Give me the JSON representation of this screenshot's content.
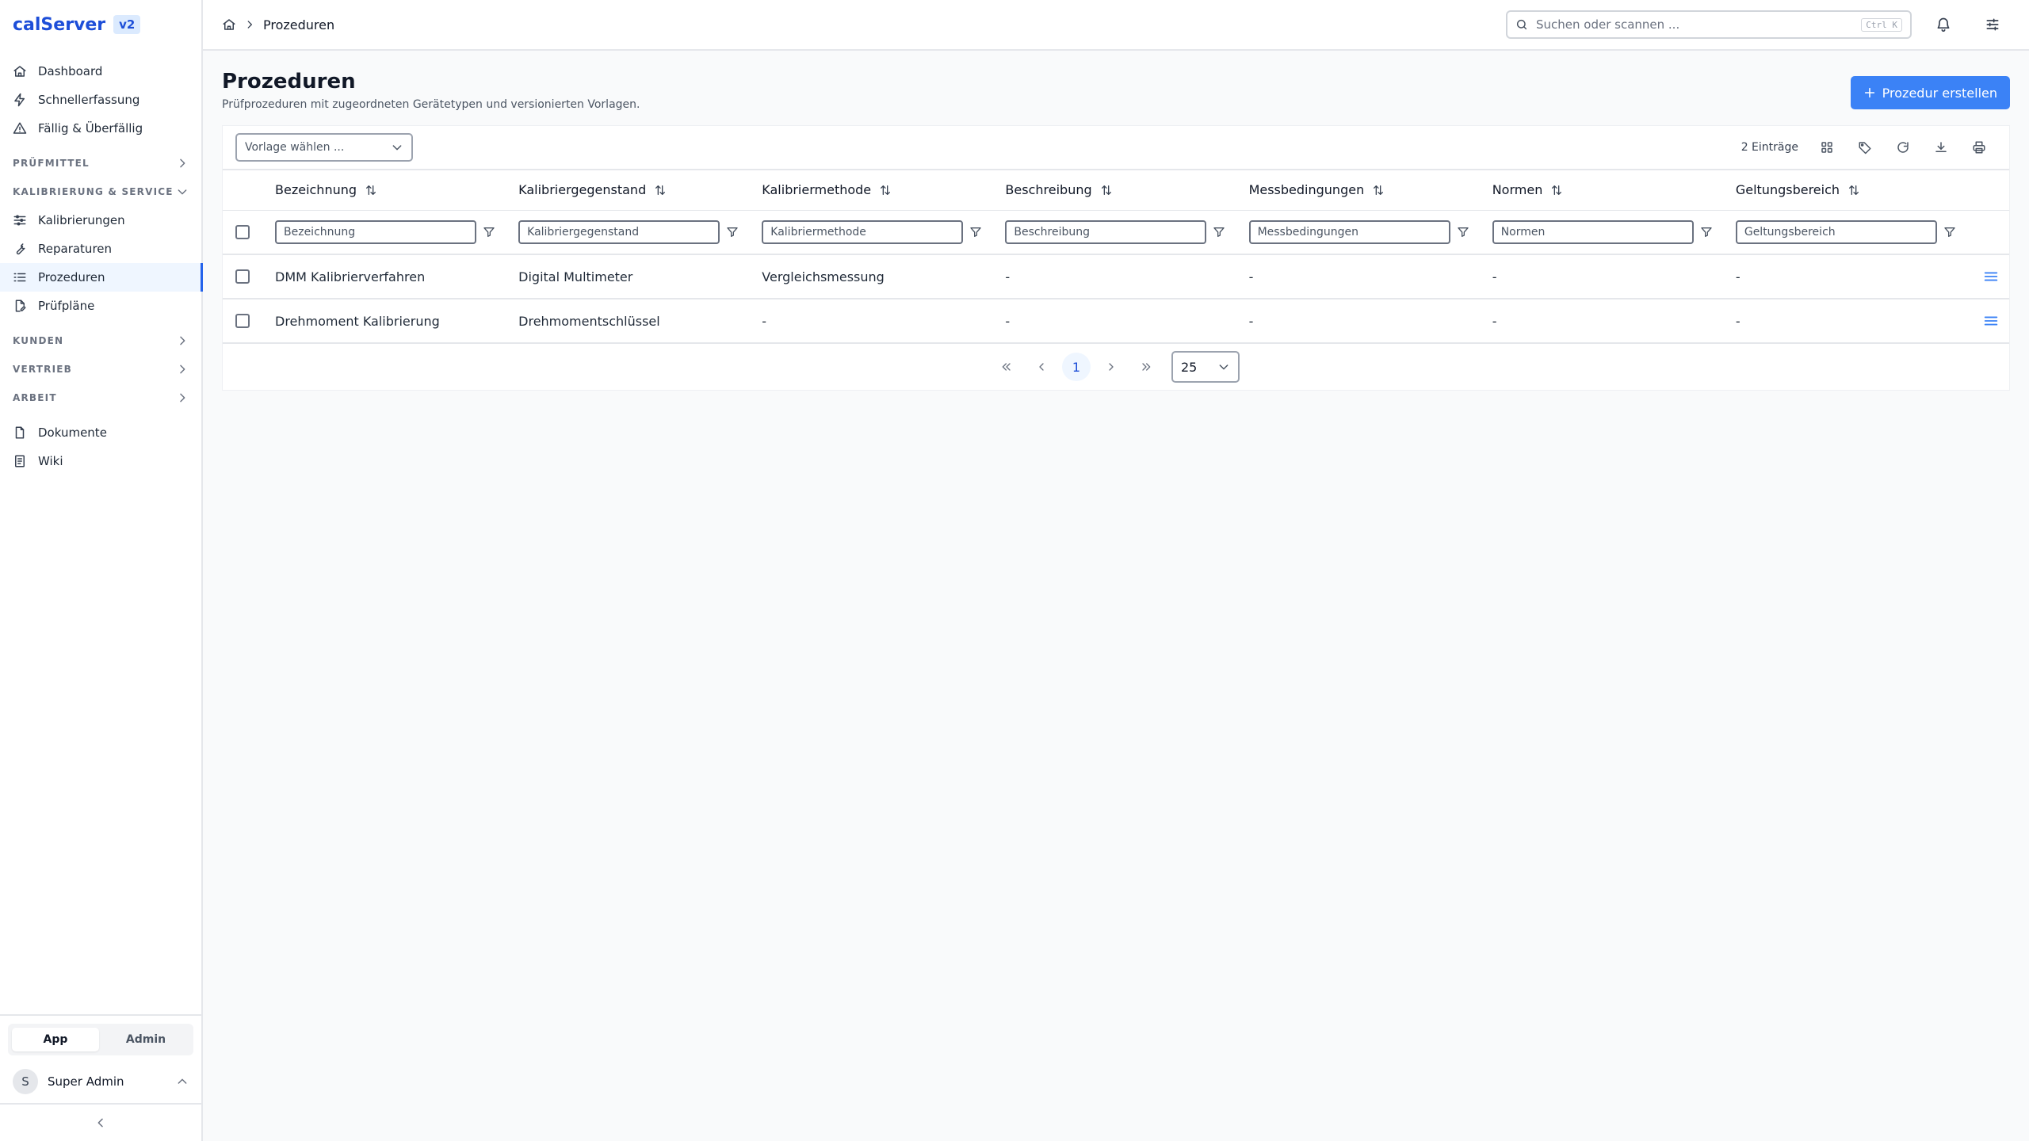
{
  "brand": {
    "name": "calServer",
    "badge": "v2"
  },
  "sidebar": {
    "top_items": [
      {
        "label": "Dashboard",
        "icon": "home-icon"
      },
      {
        "label": "Schnellerfassung",
        "icon": "bolt-icon"
      },
      {
        "label": "Fällig & Überfällig",
        "icon": "warning-icon"
      }
    ],
    "sections": {
      "pruefmittel": "PRÜFMITTEL",
      "kalibrierung": "KALIBRIERUNG & SERVICE",
      "kunden": "KUNDEN",
      "vertrieb": "VERTRIEB",
      "arbeit": "ARBEIT"
    },
    "kal_items": [
      {
        "label": "Kalibrierungen",
        "icon": "sliders-icon"
      },
      {
        "label": "Reparaturen",
        "icon": "wrench-icon"
      },
      {
        "label": "Prozeduren",
        "icon": "list-icon",
        "active": true
      },
      {
        "label": "Prüfpläne",
        "icon": "file-edit-icon"
      }
    ],
    "bottom_items": [
      {
        "label": "Dokumente",
        "icon": "document-icon"
      },
      {
        "label": "Wiki",
        "icon": "book-icon"
      }
    ],
    "mode_app": "App",
    "mode_admin": "Admin",
    "user_initial": "S",
    "user_name": "Super Admin"
  },
  "topbar": {
    "breadcrumb": "Prozeduren",
    "search_placeholder": "Suchen oder scannen ...",
    "search_shortcut": "Ctrl K"
  },
  "page": {
    "title": "Prozeduren",
    "subtitle": "Prüfprozeduren mit zugeordneten Gerätetypen und versionierten Vorlagen.",
    "create_label": "Prozedur erstellen"
  },
  "toolbar": {
    "template_placeholder": "Vorlage wählen ...",
    "count": "2 Einträge"
  },
  "table": {
    "columns": [
      {
        "label": "Bezeichnung",
        "filter": "Bezeichnung"
      },
      {
        "label": "Kalibriergegenstand",
        "filter": "Kalibriergegenstand"
      },
      {
        "label": "Kalibriermethode",
        "filter": "Kalibriermethode"
      },
      {
        "label": "Beschreibung",
        "filter": "Beschreibung"
      },
      {
        "label": "Messbedingungen",
        "filter": "Messbedingungen"
      },
      {
        "label": "Normen",
        "filter": "Normen"
      },
      {
        "label": "Geltungsbereich",
        "filter": "Geltungsbereich"
      }
    ],
    "rows": [
      {
        "cells": [
          "DMM Kalibrierverfahren",
          "Digital Multimeter",
          "Vergleichsmessung",
          "-",
          "-",
          "-",
          "-"
        ]
      },
      {
        "cells": [
          "Drehmoment Kalibrierung",
          "Drehmomentschlüssel",
          "-",
          "-",
          "-",
          "-",
          "-"
        ]
      }
    ]
  },
  "pagination": {
    "current_page": "1",
    "per_page": "25"
  },
  "colors": {
    "accent": "#3b82f6",
    "active_bg": "#eff6ff",
    "border": "#e5e7eb"
  }
}
